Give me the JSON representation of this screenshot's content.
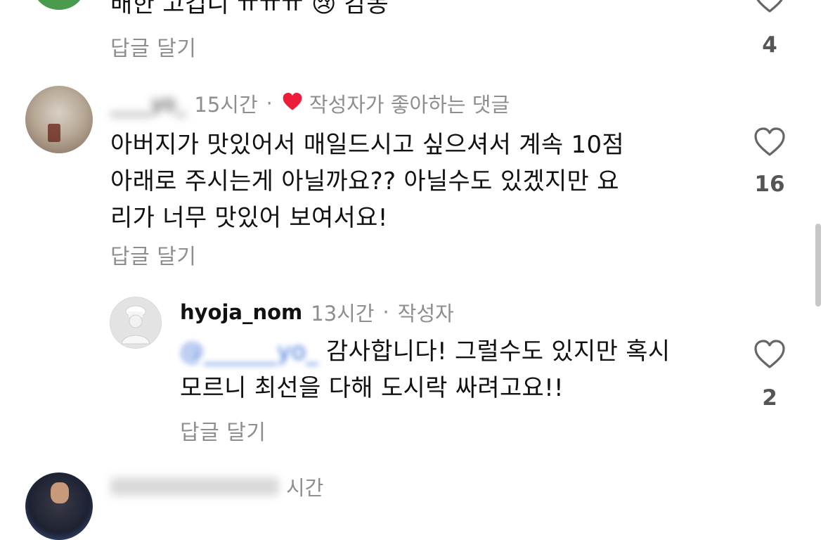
{
  "comments": [
    {
      "id": "top-cut",
      "text": "배한 고깁니 ㅠㅠㅠ 😢 감동",
      "reply_label": "답글 달기",
      "likes": "4"
    },
    {
      "id": "comment-2",
      "username": "____yo_",
      "time": "15시간",
      "sep": "·",
      "liked_by_author_label": "작성자가 좋아하는 댓글",
      "text_lines": [
        "아버지가 맛있어서 매일드시고 싶으셔서 계속 10점",
        "아래로 주시는게 아닐까요?? 아닐수도 있겠지만 요",
        "리가 너무 맛있어 보여서요!"
      ],
      "reply_label": "답글 달기",
      "likes": "16"
    },
    {
      "id": "reply-1",
      "username": "hyoja_nom",
      "time": "13시간",
      "sep": "·",
      "author_label": "작성자",
      "mention": "@______yo_",
      "text_line1_rest": " 감사합니다! 그럴수도 있지만 혹시",
      "text_line2": "모르니 최선을 다해 도시락 싸려고요!!",
      "reply_label": "답글 달기",
      "likes": "2"
    },
    {
      "id": "bottom-cut",
      "meta_partial": "시간"
    }
  ],
  "colors": {
    "heart_red": "#ed1d3a",
    "mention_blue": "#3b6fd8",
    "muted": "#8e8e8e"
  }
}
